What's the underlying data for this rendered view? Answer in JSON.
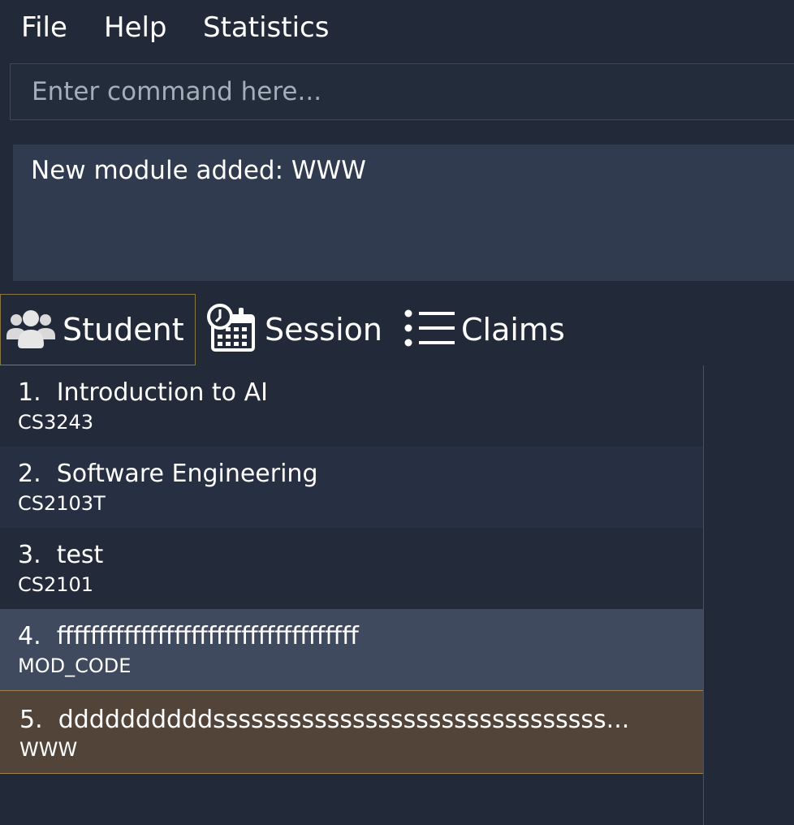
{
  "menu": {
    "file": "File",
    "help": "Help",
    "statistics": "Statistics"
  },
  "command": {
    "placeholder": "Enter command here...",
    "value": ""
  },
  "result": {
    "message": "New module added: WWW"
  },
  "tabs": [
    {
      "label": "Student",
      "icon": "users-icon",
      "active": true
    },
    {
      "label": "Session",
      "icon": "calendar-clock-icon",
      "active": false
    },
    {
      "label": "Claims",
      "icon": "list-icon",
      "active": false
    }
  ],
  "modules": [
    {
      "index": "1.",
      "name": "Introduction to AI",
      "code": "CS3243"
    },
    {
      "index": "2.",
      "name": "Software Engineering",
      "code": "CS2103T"
    },
    {
      "index": "3.",
      "name": "test",
      "code": "CS2101"
    },
    {
      "index": "4.",
      "name": "ffffffffffffffffffffffffffffffffffff",
      "code": "MOD_CODE"
    },
    {
      "index": "5.",
      "name": "ddddddddddsssssssssssssssssssssssssssssss...",
      "code": "WWW"
    }
  ],
  "colors": {
    "background": "#222a3a",
    "result_background": "#303b4f",
    "selected_row": "#3f4a5e",
    "new_row": "#53443a",
    "accent_border": "#9c8050"
  }
}
